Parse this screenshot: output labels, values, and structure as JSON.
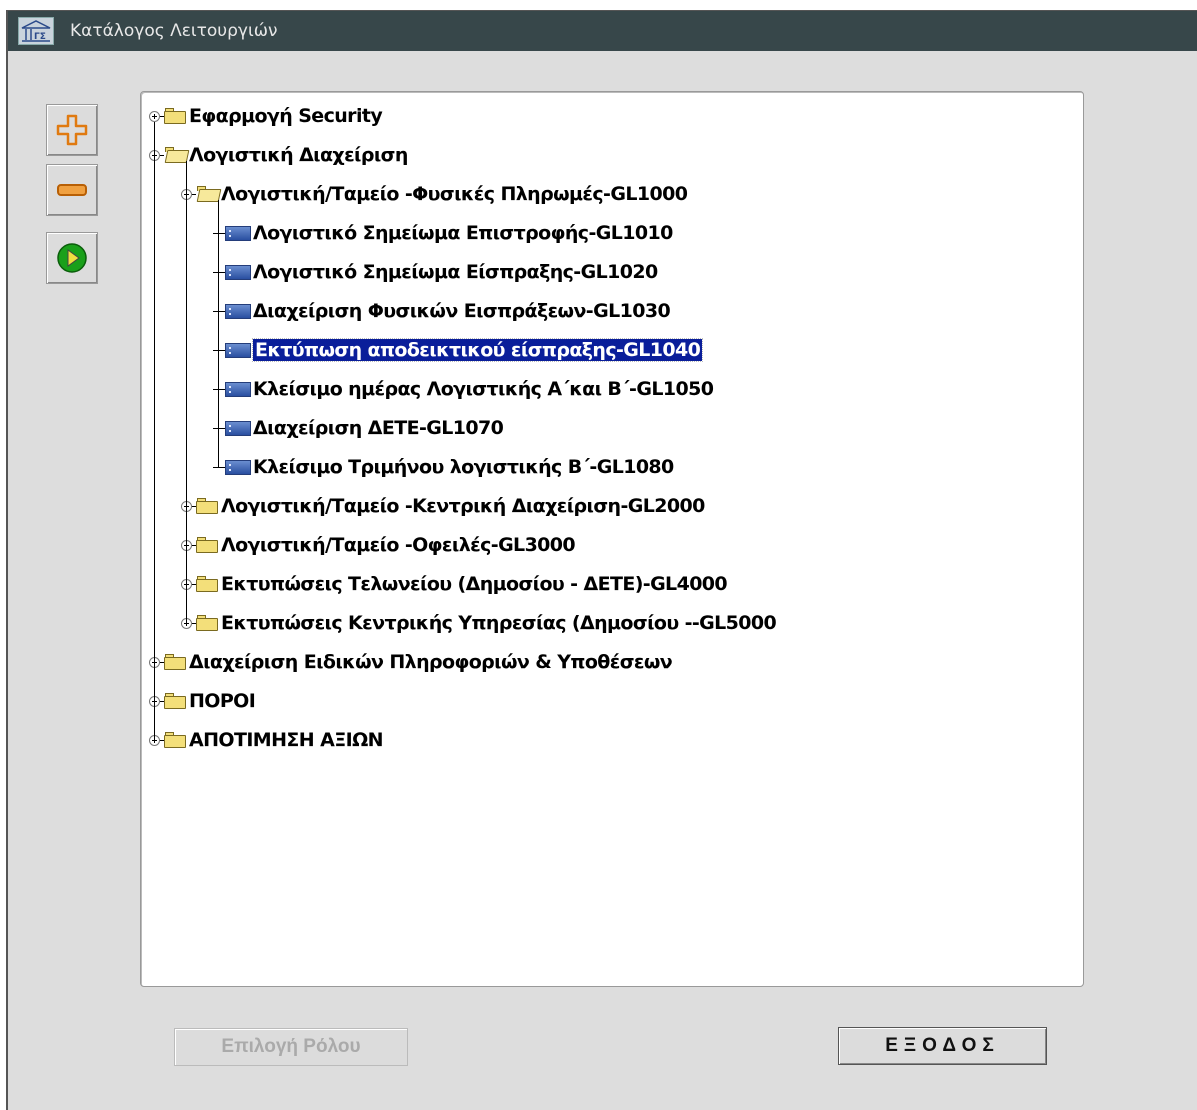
{
  "window": {
    "title": "Κατάλογος Λειτουργιών"
  },
  "toolbar": {
    "expand_icon": "plus-icon",
    "collapse_icon": "minus-icon",
    "run_icon": "play-icon"
  },
  "tree": {
    "nodes": [
      {
        "label": "Εφαρμογή Security",
        "level": 0,
        "type": "folder",
        "expanded": false
      },
      {
        "label": "Λογιστική Διαχείριση",
        "level": 0,
        "type": "folder",
        "expanded": true
      },
      {
        "label": "Λογιστική/Ταμείο -Φυσικές Πληρωμές-GL1000",
        "level": 1,
        "type": "folder",
        "expanded": true
      },
      {
        "label": "Λογιστικό Σημείωμα Επιστροφής-GL1010",
        "level": 2,
        "type": "leaf"
      },
      {
        "label": "Λογιστικό Σημείωμα Είσπραξης-GL1020",
        "level": 2,
        "type": "leaf"
      },
      {
        "label": "Διαχείριση Φυσικών Εισπράξεων-GL1030",
        "level": 2,
        "type": "leaf"
      },
      {
        "label": "Εκτύπωση αποδεικτικού είσπραξης-GL1040",
        "level": 2,
        "type": "leaf",
        "selected": true
      },
      {
        "label": "Κλείσιμο ημέρας Λογιστικής Α΄και Β΄-GL1050",
        "level": 2,
        "type": "leaf"
      },
      {
        "label": "Διαχείριση ΔΕΤΕ-GL1070",
        "level": 2,
        "type": "leaf"
      },
      {
        "label": "Κλείσιμο Τριμήνου λογιστικής Β΄-GL1080",
        "level": 2,
        "type": "leaf"
      },
      {
        "label": "Λογιστική/Ταμείο -Κεντρική Διαχείριση-GL2000",
        "level": 1,
        "type": "folder",
        "expanded": false
      },
      {
        "label": "Λογιστική/Ταμείο -Οφειλές-GL3000",
        "level": 1,
        "type": "folder",
        "expanded": false
      },
      {
        "label": "Εκτυπώσεις  Τελωνείου (Δημοσίου - ΔΕΤΕ)-GL4000",
        "level": 1,
        "type": "folder",
        "expanded": false
      },
      {
        "label": "Εκτυπώσεις  Κεντρικής Υπηρεσίας (Δημοσίου --GL5000",
        "level": 1,
        "type": "folder",
        "expanded": false
      },
      {
        "label": "Διαχείριση Ειδικών Πληροφοριών & Υποθέσεων",
        "level": 0,
        "type": "folder",
        "expanded": false
      },
      {
        "label": "ΠΟΡΟΙ",
        "level": 0,
        "type": "folder",
        "expanded": false
      },
      {
        "label": "ΑΠΟΤΙΜΗΣΗ ΑΞΙΩΝ",
        "level": 0,
        "type": "folder",
        "expanded": false
      }
    ]
  },
  "buttons": {
    "role": "Επιλογή Ρόλου",
    "exit": "ΕΞΟΔΟΣ"
  },
  "colors": {
    "titlebar": "#37474a",
    "selection": "#0a1e9a",
    "background": "#dddddd"
  }
}
